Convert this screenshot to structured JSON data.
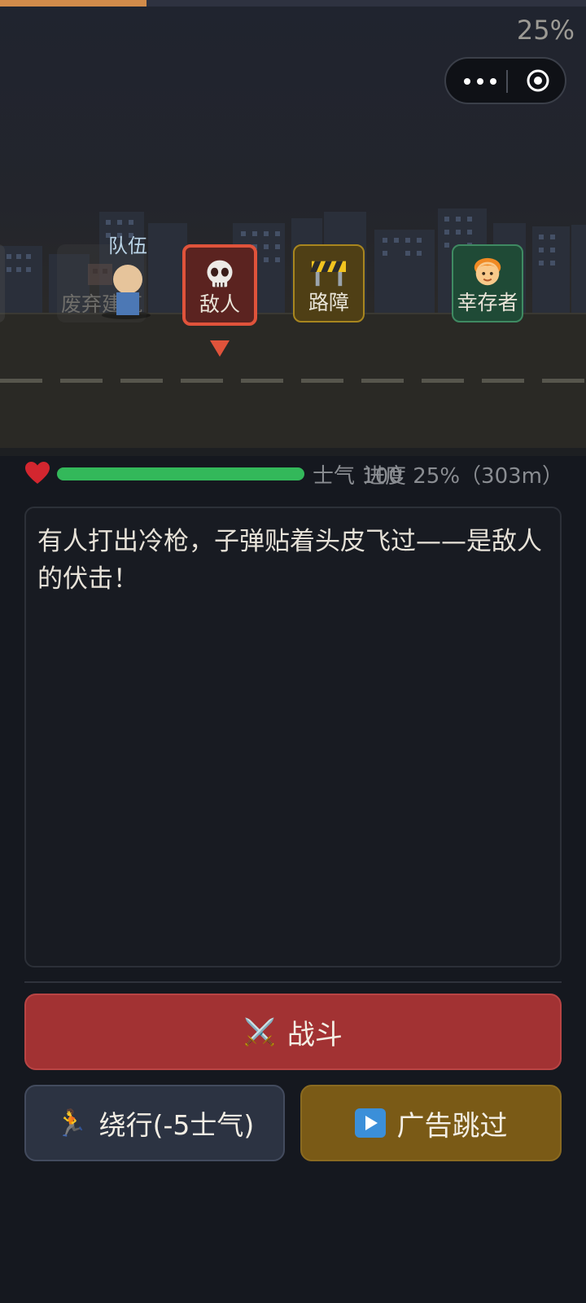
{
  "journey": {
    "progress_percent_label": "25%",
    "progress_fraction": 0.25
  },
  "scene": {
    "team_label": "队伍",
    "events": [
      {
        "type": "faded",
        "label": "废弃建筑",
        "icon": "building-icon"
      },
      {
        "type": "enemy",
        "label": "敌人",
        "icon": "skull-icon",
        "active": true
      },
      {
        "type": "barrier",
        "label": "路障",
        "icon": "barrier-icon"
      },
      {
        "type": "survivor",
        "label": "幸存者",
        "icon": "person-icon"
      }
    ]
  },
  "stats": {
    "morale_label": "士气 100",
    "morale_fraction": 1.0,
    "progress_label": "进度 25%（303m）"
  },
  "story": {
    "text": "有人打出冷枪，子弹贴着头皮飞过——是敌人的伏击！"
  },
  "actions": {
    "fight_label": "战斗",
    "fight_icon": "⚔️",
    "detour_label": "绕行(-5士气)",
    "detour_icon": "🏃",
    "skip_label": "广告跳过",
    "skip_icon": "play-icon"
  },
  "colors": {
    "enemy": "#e0533b",
    "barrier": "#a8861f",
    "survivor": "#3f8a62",
    "morale": "#33b85a",
    "progress": "#d18b4a",
    "fight": "#a23233",
    "skip": "#7a5a16"
  }
}
